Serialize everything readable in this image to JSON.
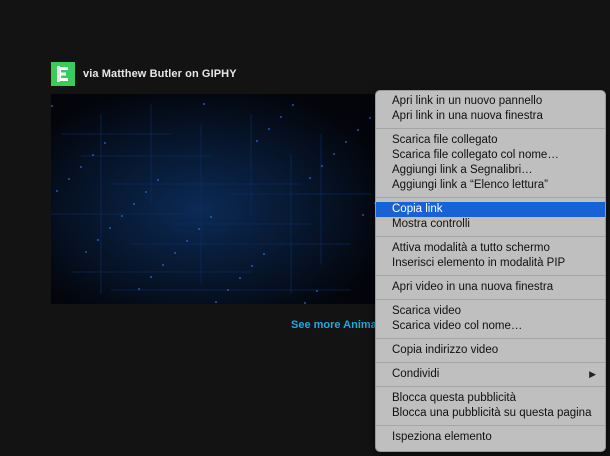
{
  "embed": {
    "attribution": "via Matthew Butler on GIPHY",
    "see_more": "See more Animat",
    "logo_icon": "giphy-logo-icon"
  },
  "colors": {
    "page_bg": "#131313",
    "menu_bg": "#bfbfbf",
    "menu_highlight": "#1962d6",
    "link_blue": "#1fa8e2",
    "logo_green": "#3ccb5a"
  },
  "context_menu": {
    "groups": [
      [
        {
          "label": "Apri link in un nuovo pannello"
        },
        {
          "label": "Apri link in una nuova finestra"
        }
      ],
      [
        {
          "label": "Scarica file collegato"
        },
        {
          "label": "Scarica file collegato col nome…"
        },
        {
          "label": "Aggiungi link a Segnalibri…"
        },
        {
          "label": "Aggiungi link a “Elenco lettura”"
        }
      ],
      [
        {
          "label": "Copia link",
          "highlighted": true
        },
        {
          "label": "Mostra controlli"
        }
      ],
      [
        {
          "label": "Attiva modalità a tutto schermo"
        },
        {
          "label": "Inserisci elemento in modalità PIP"
        }
      ],
      [
        {
          "label": "Apri video in una nuova finestra"
        }
      ],
      [
        {
          "label": "Scarica video"
        },
        {
          "label": "Scarica video col nome…"
        }
      ],
      [
        {
          "label": "Copia indirizzo video"
        }
      ],
      [
        {
          "label": "Condividi",
          "submenu": true,
          "submenu_icon": "chevron-right-icon"
        }
      ],
      [
        {
          "label": "Blocca questa pubblicità"
        },
        {
          "label": "Blocca una pubblicità su questa pagina"
        }
      ],
      [
        {
          "label": "Ispeziona elemento"
        }
      ]
    ]
  }
}
